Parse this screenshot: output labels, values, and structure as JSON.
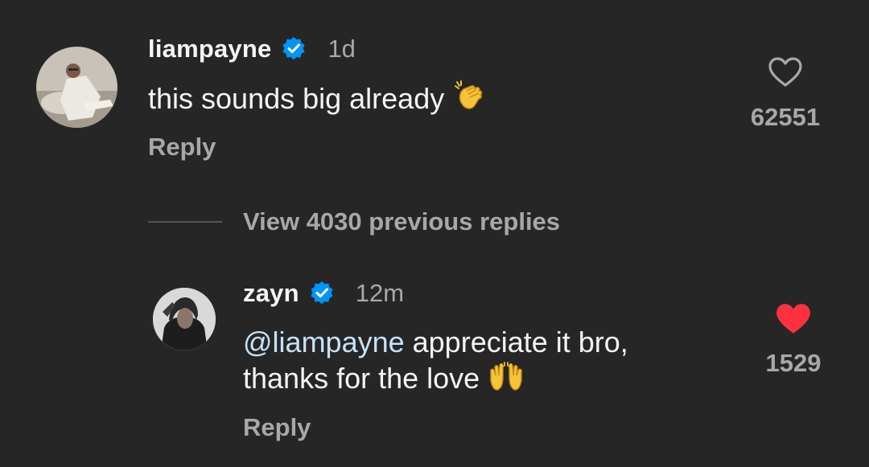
{
  "comments": [
    {
      "username": "liampayne",
      "verified": true,
      "time": "1d",
      "text": "this sounds big already",
      "emoji": "clapping-hands",
      "reply_label": "Reply",
      "likes": "62551",
      "liked": false
    }
  ],
  "view_replies": {
    "label": "View 4030 previous replies"
  },
  "reply": {
    "username": "zayn",
    "verified": true,
    "time": "12m",
    "mention": "@liampayne",
    "text_line1_rest": " appreciate it bro,",
    "text_line2": "thanks for the love",
    "emoji": "raising-hands",
    "reply_label": "Reply",
    "likes": "1529",
    "liked": true
  },
  "colors": {
    "background": "#262626",
    "text_primary": "#f5f5f5",
    "text_secondary": "#a8a8a8",
    "verified_blue": "#0095f6",
    "heart_red": "#ff3040",
    "mention": "#c7e1f7"
  }
}
